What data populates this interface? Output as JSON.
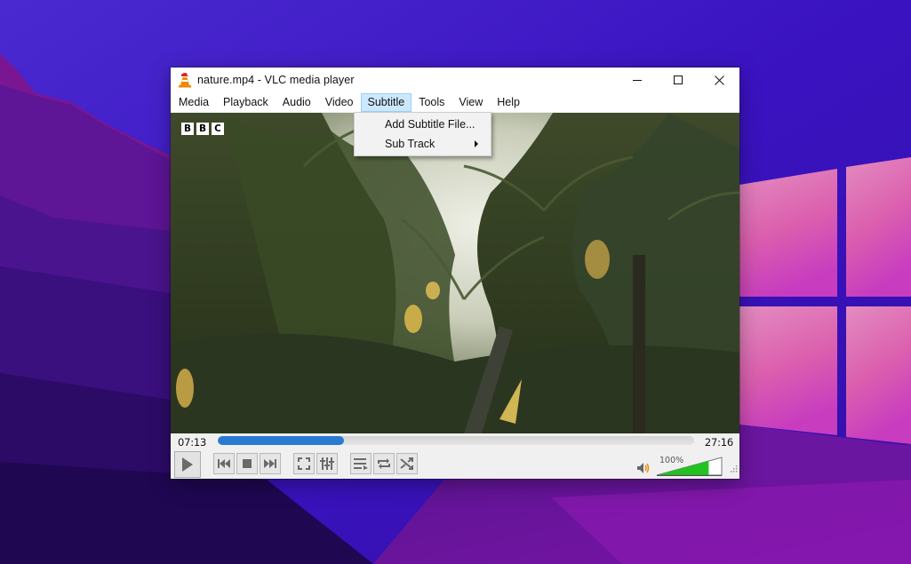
{
  "window": {
    "title": "nature.mp4 - VLC media player",
    "app_icon": "vlc-cone-icon",
    "controls": {
      "minimize": "minimize-icon",
      "maximize": "maximize-icon",
      "close": "close-icon"
    }
  },
  "menubar": {
    "items": [
      {
        "label": "Media",
        "active": false
      },
      {
        "label": "Playback",
        "active": false
      },
      {
        "label": "Audio",
        "active": false
      },
      {
        "label": "Video",
        "active": false
      },
      {
        "label": "Subtitle",
        "active": true
      },
      {
        "label": "Tools",
        "active": false
      },
      {
        "label": "View",
        "active": false
      },
      {
        "label": "Help",
        "active": false
      }
    ]
  },
  "subtitle_menu": {
    "items": [
      {
        "label": "Add Subtitle File...",
        "has_submenu": false
      },
      {
        "label": "Sub Track",
        "has_submenu": true
      }
    ]
  },
  "video": {
    "watermark": [
      "B",
      "B",
      "C"
    ]
  },
  "playback": {
    "elapsed": "07:13",
    "total": "27:16",
    "progress_fraction": 0.264
  },
  "buttons": {
    "play": "play-icon",
    "previous": "skip-previous-icon",
    "stop": "stop-icon",
    "next": "skip-next-icon",
    "fullscreen": "fullscreen-icon",
    "extended_settings": "equalizer-sliders-icon",
    "playlist": "playlist-icon",
    "loop": "loop-icon",
    "shuffle": "shuffle-icon"
  },
  "volume": {
    "label": "100%",
    "level_fraction": 0.8,
    "icon": "speaker-icon"
  },
  "colors": {
    "seek_fill": "#2a7ad2",
    "volume_fill": "#22c222",
    "menu_active_bg": "#cce8ff",
    "menu_active_border": "#99d1ff"
  }
}
